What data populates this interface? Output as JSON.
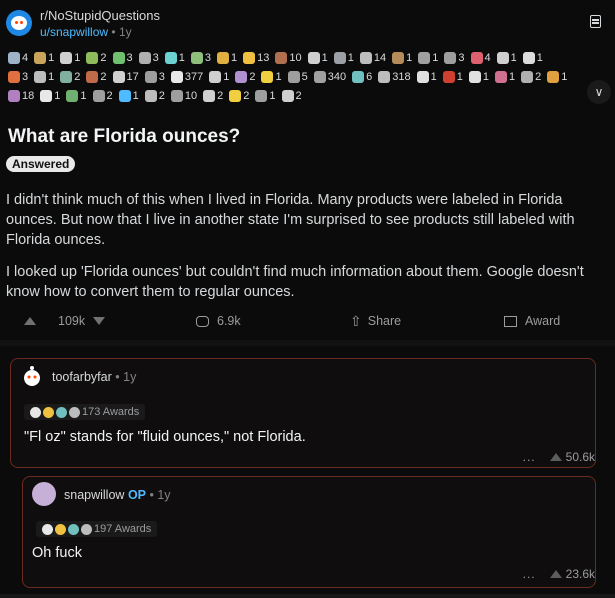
{
  "post": {
    "subreddit": "r/NoStupidQuestions",
    "author": "u/snapwillow",
    "age": "1y",
    "title": "What are Florida ounces?",
    "flair": "Answered",
    "body": [
      "I didn't think much of this when I lived in Florida. Many products were labeled in Florida ounces. But now that I live in another state I'm surprised to see products still labeled with Florida ounces.",
      "I looked up 'Florida ounces' but couldn't find much information about them. Google doesn't know how to convert them to regular ounces."
    ],
    "awards": [
      {
        "count": "4",
        "color": "#9fb3c8"
      },
      {
        "count": "1",
        "color": "#c9a45a"
      },
      {
        "count": "1",
        "color": "#d0d0d0"
      },
      {
        "count": "2",
        "color": "#8fbc5a"
      },
      {
        "count": "3",
        "color": "#6fc16f"
      },
      {
        "count": "3",
        "color": "#b0b0b0"
      },
      {
        "count": "1",
        "color": "#6bd1d1"
      },
      {
        "count": "3",
        "color": "#8ec07c"
      },
      {
        "count": "1",
        "color": "#e0b040"
      },
      {
        "count": "13",
        "color": "#f0c040"
      },
      {
        "count": "10",
        "color": "#b07050"
      },
      {
        "count": "1",
        "color": "#cfcfcf"
      },
      {
        "count": "1",
        "color": "#9aa0a6"
      },
      {
        "count": "14",
        "color": "#bdbdbd"
      },
      {
        "count": "1",
        "color": "#b58b5a"
      },
      {
        "count": "1",
        "color": "#a0a0a0"
      },
      {
        "count": "3",
        "color": "#9e9e9e"
      },
      {
        "count": "4",
        "color": "#e06070"
      },
      {
        "count": "1",
        "color": "#cfcfcf"
      },
      {
        "count": "1",
        "color": "#dcdcdc"
      },
      {
        "count": "3",
        "color": "#e07040"
      },
      {
        "count": "1",
        "color": "#bdbdbd"
      },
      {
        "count": "2",
        "color": "#7fb0a0"
      },
      {
        "count": "2",
        "color": "#c06a4a"
      },
      {
        "count": "17",
        "color": "#d0d0d0"
      },
      {
        "count": "3",
        "color": "#9e9e9e"
      },
      {
        "count": "377",
        "color": "#e8e8e8"
      },
      {
        "count": "1",
        "color": "#cfcfcf"
      },
      {
        "count": "2",
        "color": "#b090d0"
      },
      {
        "count": "1",
        "color": "#f0d040"
      },
      {
        "count": "5",
        "color": "#9e9e9e"
      },
      {
        "count": "340",
        "color": "#a0a0a0"
      },
      {
        "count": "6",
        "color": "#70c0c0"
      },
      {
        "count": "318",
        "color": "#bdbdbd"
      },
      {
        "count": "1",
        "color": "#e0e0e0"
      },
      {
        "count": "1",
        "color": "#d04030"
      },
      {
        "count": "1",
        "color": "#e0e0e0"
      },
      {
        "count": "1",
        "color": "#d07090"
      },
      {
        "count": "2",
        "color": "#b0b0b0"
      },
      {
        "count": "1",
        "color": "#e0a040"
      },
      {
        "count": "18",
        "color": "#b080c0"
      },
      {
        "count": "1",
        "color": "#e8e8e8"
      },
      {
        "count": "1",
        "color": "#70b070"
      },
      {
        "count": "2",
        "color": "#9e9e9e"
      },
      {
        "count": "1",
        "color": "#4fbcff"
      },
      {
        "count": "2",
        "color": "#bdbdbd"
      },
      {
        "count": "10",
        "color": "#9e9e9e"
      },
      {
        "count": "2",
        "color": "#d0d0d0"
      },
      {
        "count": "2",
        "color": "#f0d040"
      },
      {
        "count": "1",
        "color": "#9e9e9e"
      },
      {
        "count": "2",
        "color": "#cfcfcf"
      }
    ],
    "actions": {
      "votes": "109k",
      "comments": "6.9k",
      "share": "Share",
      "award": "Award"
    }
  },
  "comments": [
    {
      "author": "toofarbyfar",
      "age": "1y",
      "awards_label": "173 Awards",
      "text": "\"Fl oz\" stands for \"fluid ounces,\" not Florida.",
      "score": "50.6k",
      "more": "..."
    },
    {
      "author": "snapwillow",
      "op_badge": "OP",
      "age": "1y",
      "awards_label": "197 Awards",
      "text": "Oh fuck",
      "score": "23.6k",
      "more": "..."
    }
  ],
  "meta": {
    "dot": "•"
  },
  "colors": {
    "accent": "#4fbcff",
    "orange": "#ff4500",
    "comment_border": "#6b2a1f"
  }
}
